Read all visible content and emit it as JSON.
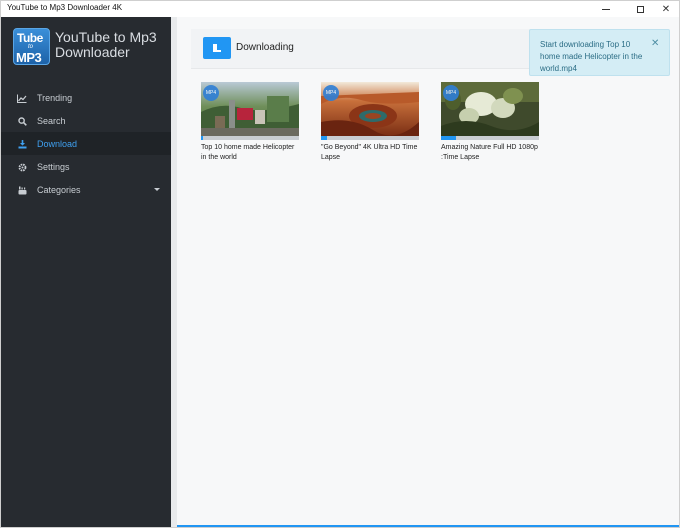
{
  "window": {
    "title": "YouTube to Mp3 Downloader 4K",
    "min_glyph": "—",
    "close_glyph": "✕"
  },
  "sidebar": {
    "logo": {
      "line1": "Tube",
      "line2": "to",
      "line3": "MP3"
    },
    "brand": "YouTube to Mp3 Downloader",
    "items": [
      {
        "label": "Trending",
        "icon": "trending-icon"
      },
      {
        "label": "Search",
        "icon": "search-icon"
      },
      {
        "label": "Download",
        "icon": "download-icon",
        "active": true
      },
      {
        "label": "Settings",
        "icon": "gear-icon"
      },
      {
        "label": "Categories",
        "icon": "youtube-icon",
        "has_caret": true
      }
    ]
  },
  "main": {
    "header": {
      "title": "Downloading",
      "icon": "download-list-icon"
    },
    "downloads": [
      {
        "title": "Top 10 home made Helicopter in the world",
        "badge": "MP4",
        "progress": 0.02
      },
      {
        "title": "\"Go Beyond\" 4K Ultra HD Time Lapse",
        "badge": "MP4",
        "progress": 0.06
      },
      {
        "title": "Amazing Nature Full HD 1080p :Time Lapse",
        "badge": "MP4",
        "progress": 0.15
      }
    ]
  },
  "toast": {
    "message": "Start downloading Top 10 home made Helicopter in the world.mp4",
    "close_glyph": "✕"
  },
  "colors": {
    "accent": "#2196f3",
    "sidebar_bg": "#272b30",
    "toast_bg": "#d4edf5",
    "toast_text": "#2b6d85"
  }
}
